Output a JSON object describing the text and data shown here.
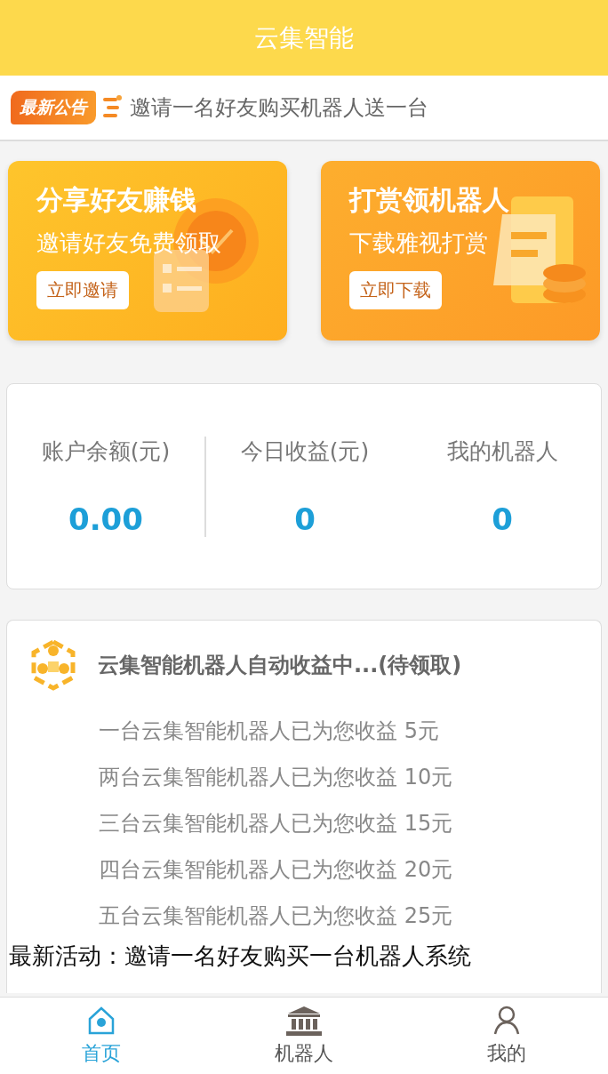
{
  "header": {
    "title": "云集智能"
  },
  "notice": {
    "badge": "最新公告",
    "text": "邀请一名好友购买机器人送一台"
  },
  "promos": [
    {
      "kind": "invite",
      "title": "分享好友赚钱",
      "subtitle": "邀请好友免费领取",
      "button": "立即邀请"
    },
    {
      "kind": "download",
      "title": "打赏领机器人",
      "subtitle": "下载雅视打赏",
      "button": "立即下载"
    }
  ],
  "stats": [
    {
      "label": "账户余额(元)",
      "value": "0.00"
    },
    {
      "label": "今日收益(元)",
      "value": "0"
    },
    {
      "label": "我的机器人",
      "value": "0"
    }
  ],
  "earnings": {
    "title": "云集智能机器人自动收益中...(待领取)",
    "lines": [
      "一台云集智能机器人已为您收益 5元",
      "两台云集智能机器人已为您收益 10元",
      "三台云集智能机器人已为您收益 15元",
      "四台云集智能机器人已为您收益 20元",
      "五台云集智能机器人已为您收益 25元"
    ]
  },
  "activity": "最新活动：邀请一名好友购买一台机器人系统",
  "tabs": [
    {
      "label": "首页",
      "kind": "home",
      "selected": true
    },
    {
      "label": "机器人",
      "kind": "bank",
      "selected": false
    },
    {
      "label": "我的",
      "kind": "person",
      "selected": false
    }
  ]
}
